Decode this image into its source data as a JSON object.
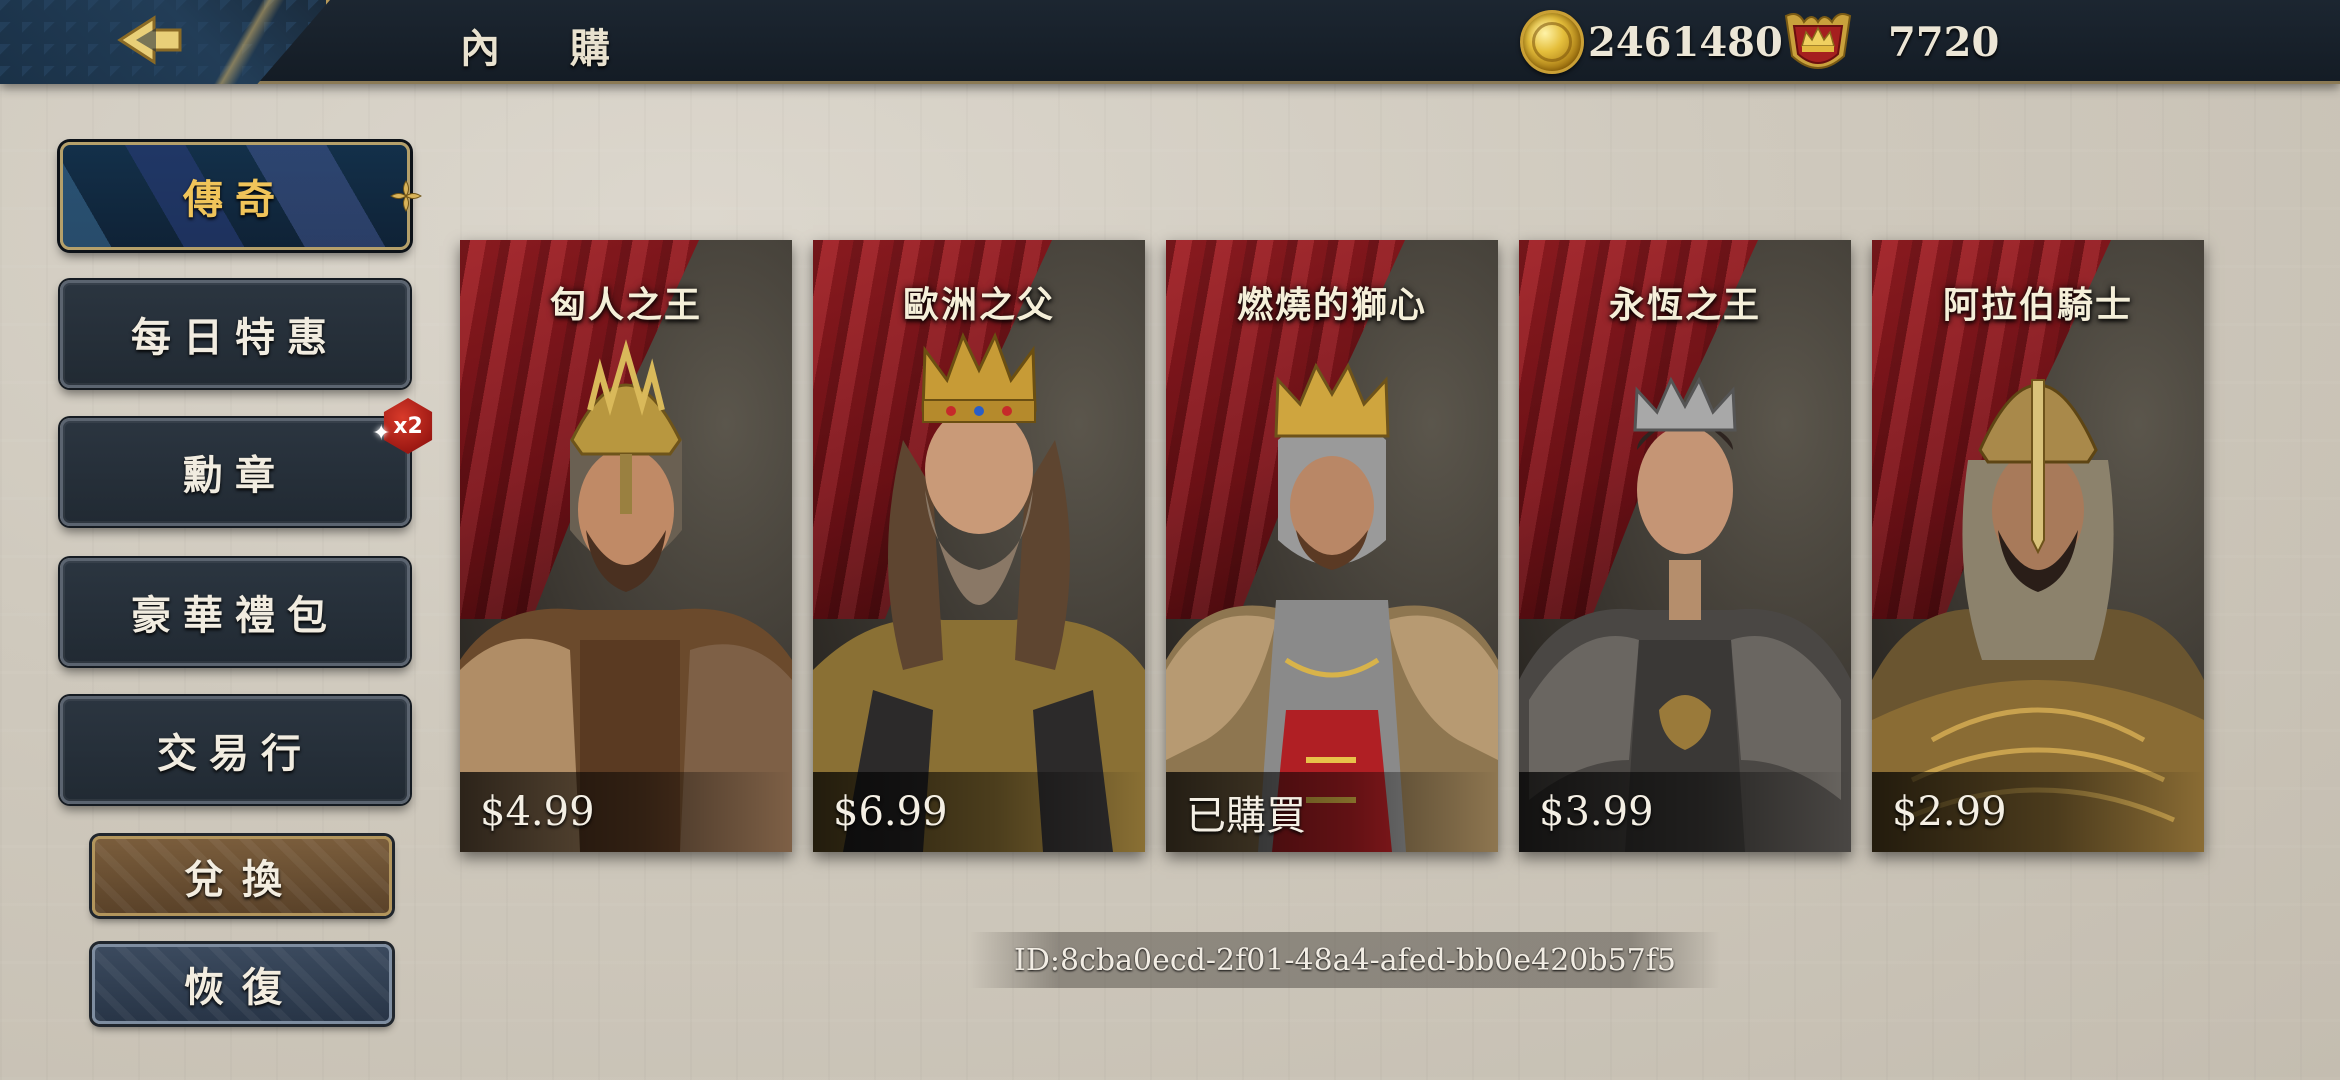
{
  "header": {
    "title": "內 購",
    "gold_amount": "2461480",
    "crown_amount": "7720",
    "icons": {
      "back": "back-arrow-icon",
      "gold": "gold-coin-icon",
      "crown": "crown-shield-icon"
    }
  },
  "sidebar": {
    "items": [
      {
        "label": "傳奇",
        "active": true
      },
      {
        "label": "每日特惠",
        "active": false
      },
      {
        "label": "勳章",
        "active": false,
        "badge": "x2"
      },
      {
        "label": "豪華禮包",
        "active": false
      },
      {
        "label": "交易行",
        "active": false
      }
    ],
    "redeem_label": "兌換",
    "restore_label": "恢復"
  },
  "heroes": [
    {
      "name": "匈人之王",
      "price": "$4.99"
    },
    {
      "name": "歐洲之父",
      "price": "$6.99"
    },
    {
      "name": "燃燒的獅心",
      "price": "已購買"
    },
    {
      "name": "永恆之王",
      "price": "$3.99"
    },
    {
      "name": "阿拉伯騎士",
      "price": "$2.99"
    }
  ],
  "footer": {
    "id_text": "ID:8cba0ecd-2f01-48a4-afed-bb0e420b57f5"
  },
  "colors": {
    "gold_text": "#f0c45a",
    "curtain_red": "#a01e24",
    "panel_dark": "#212a33"
  }
}
